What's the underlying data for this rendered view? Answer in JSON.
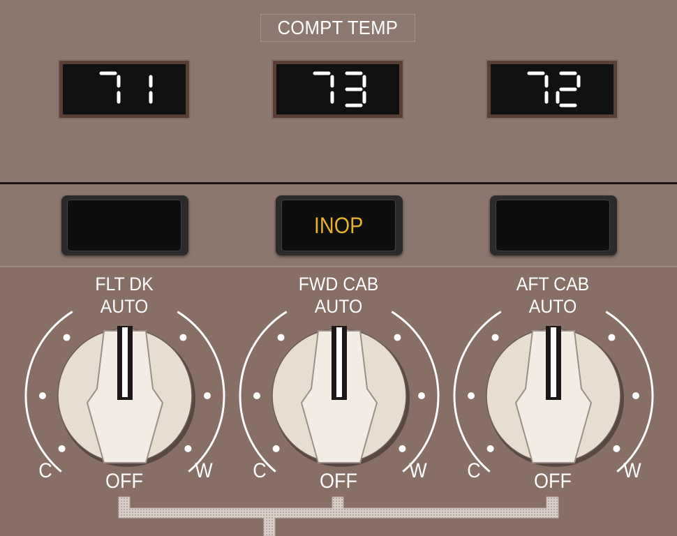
{
  "panel": {
    "title": "COMPT TEMP",
    "displays": [
      {
        "value": "71"
      },
      {
        "value": "73"
      },
      {
        "value": "72"
      }
    ],
    "lights": [
      {
        "label": ""
      },
      {
        "label": "INOP"
      },
      {
        "label": ""
      }
    ],
    "selectors": [
      {
        "name": "FLT DK",
        "auto": "AUTO",
        "cool": "C",
        "off": "OFF",
        "warm": "W"
      },
      {
        "name": "FWD CAB",
        "auto": "AUTO",
        "cool": "C",
        "off": "OFF",
        "warm": "W"
      },
      {
        "name": "AFT CAB",
        "auto": "AUTO",
        "cool": "C",
        "off": "OFF",
        "warm": "W"
      }
    ],
    "colors": {
      "panel": "#8b776d",
      "segment": "#ffffff",
      "inop": "#e6b12c",
      "knob": "#e8ddd1"
    }
  }
}
